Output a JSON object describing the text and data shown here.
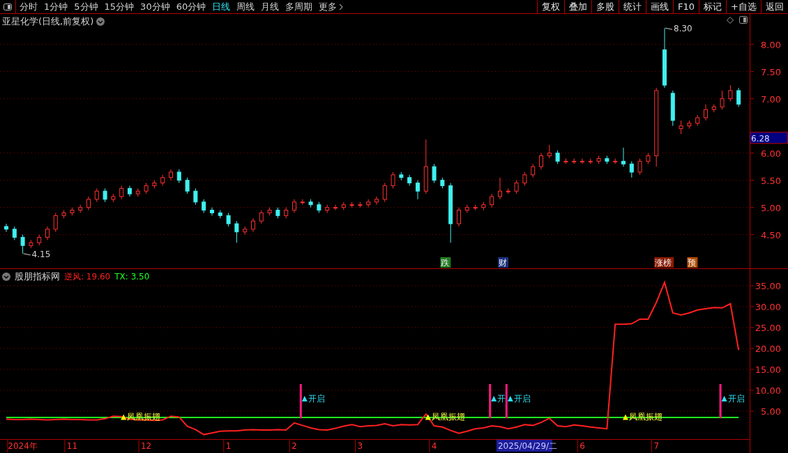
{
  "toolbar": {
    "tabs": [
      {
        "label": "分时",
        "selected": false
      },
      {
        "label": "1分钟",
        "selected": false
      },
      {
        "label": "5分钟",
        "selected": false
      },
      {
        "label": "15分钟",
        "selected": false
      },
      {
        "label": "30分钟",
        "selected": false
      },
      {
        "label": "60分钟",
        "selected": false
      },
      {
        "label": "日线",
        "selected": true
      },
      {
        "label": "周线",
        "selected": false
      },
      {
        "label": "月线",
        "selected": false
      },
      {
        "label": "多周期",
        "selected": false
      },
      {
        "label": "更多",
        "selected": false
      }
    ],
    "buttons": [
      "复权",
      "叠加",
      "多股",
      "统计",
      "画线",
      "F10",
      "标记",
      "+自选",
      "返回"
    ]
  },
  "price_panel": {
    "title": "亚星化学(日线,前复权)",
    "last_price": "6.28",
    "chart_data": {
      "type": "candlestick",
      "grid": true,
      "ylim": [
        3.88,
        8.56
      ],
      "yticks": [
        {
          "value": 4.5,
          "label": "4.50"
        },
        {
          "value": 5,
          "label": "5.00"
        },
        {
          "value": 5.5,
          "label": "5.50"
        },
        {
          "value": 6,
          "label": "6.00"
        },
        {
          "value": 7,
          "label": "7.00"
        },
        {
          "value": 7.5,
          "label": "7.50"
        },
        {
          "value": 8,
          "label": "8.00"
        }
      ],
      "categories": [
        null,
        null,
        null,
        null,
        null,
        null,
        null,
        null,
        null,
        null,
        null,
        null,
        null,
        null,
        null,
        null,
        null,
        null,
        null,
        null,
        null,
        null,
        null,
        null,
        null,
        null,
        null,
        null,
        null,
        null,
        null,
        null,
        null,
        null,
        null,
        null,
        null,
        null,
        null,
        null,
        null,
        null,
        null,
        null,
        null,
        null,
        null,
        null,
        null,
        null,
        null,
        null,
        null,
        null,
        null,
        null,
        null,
        null,
        null,
        null,
        null,
        null,
        null,
        null,
        null,
        null,
        null,
        null,
        null,
        null,
        null,
        null,
        null,
        null,
        null,
        null,
        null,
        null,
        null,
        null,
        null,
        null,
        null,
        null,
        null,
        null,
        null,
        null,
        null,
        null
      ],
      "ohlc": [
        [
          4.65,
          4.7,
          4.55,
          4.6
        ],
        [
          4.6,
          4.65,
          4.4,
          4.45
        ],
        [
          4.45,
          4.5,
          4.15,
          4.3
        ],
        [
          4.3,
          4.4,
          4.25,
          4.35
        ],
        [
          4.35,
          4.5,
          4.3,
          4.45
        ],
        [
          4.45,
          4.65,
          4.4,
          4.6
        ],
        [
          4.6,
          4.9,
          4.55,
          4.85
        ],
        [
          4.85,
          4.95,
          4.8,
          4.9
        ],
        [
          4.9,
          5.0,
          4.85,
          4.95
        ],
        [
          4.95,
          5.05,
          4.9,
          5.0
        ],
        [
          5.0,
          5.2,
          4.95,
          5.15
        ],
        [
          5.15,
          5.35,
          5.1,
          5.3
        ],
        [
          5.3,
          5.35,
          5.1,
          5.15
        ],
        [
          5.15,
          5.25,
          5.1,
          5.2
        ],
        [
          5.2,
          5.4,
          5.15,
          5.35
        ],
        [
          5.35,
          5.4,
          5.2,
          5.25
        ],
        [
          5.25,
          5.35,
          5.2,
          5.3
        ],
        [
          5.3,
          5.45,
          5.25,
          5.4
        ],
        [
          5.4,
          5.5,
          5.35,
          5.45
        ],
        [
          5.45,
          5.6,
          5.4,
          5.55
        ],
        [
          5.55,
          5.7,
          5.5,
          5.65
        ],
        [
          5.65,
          5.7,
          5.45,
          5.5
        ],
        [
          5.5,
          5.55,
          5.25,
          5.3
        ],
        [
          5.3,
          5.35,
          5.05,
          5.1
        ],
        [
          5.1,
          5.15,
          4.9,
          4.95
        ],
        [
          4.95,
          5.0,
          4.85,
          4.9
        ],
        [
          4.9,
          4.95,
          4.8,
          4.85
        ],
        [
          4.85,
          4.9,
          4.65,
          4.7
        ],
        [
          4.7,
          4.75,
          4.35,
          4.55
        ],
        [
          4.55,
          4.65,
          4.5,
          4.6
        ],
        [
          4.6,
          4.8,
          4.55,
          4.75
        ],
        [
          4.75,
          4.95,
          4.7,
          4.9
        ],
        [
          4.9,
          5.0,
          4.85,
          4.95
        ],
        [
          4.95,
          5.0,
          4.8,
          4.85
        ],
        [
          4.85,
          5.0,
          4.8,
          4.95
        ],
        [
          4.95,
          5.15,
          4.9,
          5.1
        ],
        [
          5.1,
          5.15,
          5.05,
          5.1
        ],
        [
          5.1,
          5.15,
          5.0,
          5.05
        ],
        [
          5.05,
          5.1,
          4.9,
          4.95
        ],
        [
          4.95,
          5.05,
          4.9,
          5.0
        ],
        [
          5.0,
          5.05,
          4.95,
          5.0
        ],
        [
          5.0,
          5.1,
          4.95,
          5.05
        ],
        [
          5.05,
          5.1,
          5.0,
          5.05
        ],
        [
          5.05,
          5.1,
          5.0,
          5.05
        ],
        [
          5.05,
          5.15,
          5.0,
          5.1
        ],
        [
          5.1,
          5.2,
          5.05,
          5.15
        ],
        [
          5.15,
          5.45,
          5.1,
          5.4
        ],
        [
          5.4,
          5.65,
          5.35,
          5.6
        ],
        [
          5.6,
          5.65,
          5.5,
          5.55
        ],
        [
          5.55,
          5.6,
          5.4,
          5.45
        ],
        [
          5.45,
          5.5,
          5.15,
          5.3
        ],
        [
          5.3,
          6.25,
          5.25,
          5.75
        ],
        [
          5.75,
          5.8,
          5.45,
          5.5
        ],
        [
          5.5,
          5.55,
          5.35,
          5.4
        ],
        [
          5.4,
          5.45,
          4.35,
          4.7
        ],
        [
          4.7,
          5.0,
          4.65,
          4.95
        ],
        [
          4.95,
          5.05,
          4.9,
          5.0
        ],
        [
          5.0,
          5.05,
          4.95,
          5.0
        ],
        [
          5.0,
          5.1,
          4.95,
          5.05
        ],
        [
          5.05,
          5.25,
          5.0,
          5.2
        ],
        [
          5.2,
          5.55,
          5.15,
          5.3
        ],
        [
          5.3,
          5.35,
          5.25,
          5.3
        ],
        [
          5.3,
          5.5,
          5.25,
          5.45
        ],
        [
          5.45,
          5.65,
          5.4,
          5.6
        ],
        [
          5.6,
          5.8,
          5.55,
          5.75
        ],
        [
          5.75,
          6.0,
          5.7,
          5.95
        ],
        [
          5.95,
          6.15,
          5.9,
          6.0
        ],
        [
          6.0,
          6.05,
          5.8,
          5.85
        ],
        [
          5.85,
          5.9,
          5.8,
          5.85
        ],
        [
          5.85,
          5.9,
          5.8,
          5.85
        ],
        [
          5.85,
          5.9,
          5.8,
          5.85
        ],
        [
          5.85,
          5.9,
          5.8,
          5.85
        ],
        [
          5.85,
          5.95,
          5.8,
          5.9
        ],
        [
          5.9,
          5.95,
          5.8,
          5.85
        ],
        [
          5.85,
          5.9,
          5.8,
          5.85
        ],
        [
          5.85,
          6.1,
          5.75,
          5.8
        ],
        [
          5.8,
          5.85,
          5.55,
          5.65
        ],
        [
          5.65,
          5.9,
          5.6,
          5.85
        ],
        [
          5.85,
          6.0,
          5.8,
          5.95
        ],
        [
          5.95,
          7.2,
          5.75,
          7.15
        ],
        [
          7.9,
          8.3,
          7.2,
          7.25
        ],
        [
          7.1,
          7.15,
          6.5,
          6.6
        ],
        [
          6.45,
          6.6,
          6.35,
          6.5
        ],
        [
          6.5,
          6.6,
          6.45,
          6.55
        ],
        [
          6.55,
          6.7,
          6.5,
          6.65
        ],
        [
          6.65,
          6.9,
          6.6,
          6.8
        ],
        [
          6.8,
          6.9,
          6.75,
          6.85
        ],
        [
          6.85,
          7.15,
          6.8,
          7.0
        ],
        [
          7.0,
          7.25,
          6.95,
          7.15
        ],
        [
          7.15,
          7.2,
          6.85,
          6.9
        ]
      ],
      "annotations": [
        "4.15",
        "8.30"
      ]
    },
    "event_tags": [
      {
        "label": "跌",
        "color": "#1f7a1f"
      },
      {
        "label": "财",
        "color": "#1b2f7a"
      },
      {
        "label": "涨榜",
        "color": "#8b1a00"
      },
      {
        "label": "预",
        "color": "#b04a00"
      }
    ]
  },
  "indicator_panel": {
    "title": "股朋指标网",
    "legend": [
      {
        "text": "逆风: 19.60",
        "color": "#ff2020"
      },
      {
        "text": "TX: 3.50",
        "color": "#20ff20"
      }
    ],
    "chart_data": {
      "type": "line",
      "grid": true,
      "ylim": [
        -1.67,
        39
      ],
      "yticks": [
        {
          "value": 5,
          "label": "5.00"
        },
        {
          "value": 10,
          "label": "10.00"
        },
        {
          "value": 15,
          "label": "15.00"
        },
        {
          "value": 20,
          "label": "20.00"
        },
        {
          "value": 25,
          "label": "25.00"
        },
        {
          "value": 30,
          "label": "30.00"
        },
        {
          "value": 35,
          "label": "35.00"
        }
      ],
      "categories": [
        null,
        null,
        "2024年",
        null,
        null,
        null,
        null,
        null,
        "11",
        null,
        null,
        null,
        null,
        null,
        null,
        null,
        null,
        "12",
        null,
        null,
        null,
        null,
        null,
        null,
        null,
        null,
        null,
        "1",
        null,
        null,
        null,
        null,
        null,
        null,
        null,
        "2",
        null,
        null,
        null,
        null,
        null,
        null,
        null,
        "3",
        null,
        null,
        null,
        null,
        null,
        null,
        null,
        null,
        "4",
        null,
        null,
        null,
        null,
        null,
        null,
        null,
        null,
        null,
        null,
        null,
        null,
        null,
        null,
        null,
        null,
        null,
        "6",
        null,
        null,
        null,
        null,
        null,
        null,
        null,
        null,
        "7",
        null,
        null,
        null,
        null,
        null,
        null,
        null,
        null,
        null,
        null
      ],
      "series": [
        {
          "color": "#ff2020",
          "values": [
            3.1,
            3.0,
            3.0,
            3.1,
            3.0,
            2.9,
            3.0,
            3.1,
            3.0,
            3.0,
            2.9,
            2.9,
            3.2,
            3.8,
            3.7,
            3.1,
            2.9,
            2.9,
            2.8,
            2.9,
            3.8,
            3.6,
            1.4,
            0.6,
            -0.6,
            -0.2,
            0.2,
            0.3,
            0.3,
            0.5,
            0.6,
            0.5,
            0.5,
            0.6,
            0.5,
            2.2,
            1.6,
            1.0,
            0.6,
            0.5,
            0.9,
            1.4,
            1.8,
            1.3,
            1.5,
            1.6,
            2.0,
            1.5,
            1.8,
            1.7,
            1.8,
            4.3,
            1.5,
            1.2,
            0.4,
            -0.3,
            0.2,
            0.8,
            1.0,
            1.5,
            1.3,
            0.8,
            1.2,
            1.8,
            1.6,
            2.3,
            3.3,
            1.5,
            1.3,
            1.7,
            1.5,
            1.2,
            1.0,
            0.8,
            25.8,
            25.8,
            25.9,
            27.0,
            27.0,
            31,
            35.8,
            28.5,
            28.0,
            28.5,
            29.2,
            29.5,
            29.8,
            29.7,
            30.7,
            19.6
          ]
        },
        {
          "color": "#20ff20",
          "values": [
            3.5,
            3.5,
            3.5,
            3.5,
            3.5,
            3.5,
            3.5,
            3.5,
            3.5,
            3.5,
            3.5,
            3.5,
            3.5,
            3.5,
            3.5,
            3.5,
            3.5,
            3.5,
            3.5,
            3.5,
            3.5,
            3.5,
            3.5,
            3.5,
            3.5,
            3.5,
            3.5,
            3.5,
            3.5,
            3.5,
            3.5,
            3.5,
            3.5,
            3.5,
            3.5,
            3.5,
            3.5,
            3.5,
            3.5,
            3.5,
            3.5,
            3.5,
            3.5,
            3.5,
            3.5,
            3.5,
            3.5,
            3.5,
            3.5,
            3.5,
            3.5,
            3.5,
            3.5,
            3.5,
            3.5,
            3.5,
            3.5,
            3.5,
            3.5,
            3.5,
            3.5,
            3.5,
            3.5,
            3.5,
            3.5,
            3.5,
            3.5,
            3.5,
            3.5,
            3.5,
            3.5,
            3.5,
            3.5,
            3.5,
            3.5,
            3.5,
            3.5,
            3.5,
            3.5,
            3.5,
            3.5,
            3.5,
            3.5,
            3.5,
            3.5,
            3.5,
            3.5,
            3.5,
            3.5,
            3.5
          ]
        }
      ]
    },
    "signals": [
      {
        "kind": "rise",
        "label": "凤凰振翅"
      },
      {
        "kind": "open",
        "label": "开启"
      },
      {
        "kind": "rise",
        "label": "凤凰振翅"
      },
      {
        "kind": "open",
        "label": "开"
      },
      {
        "kind": "open",
        "label": "开启"
      },
      {
        "kind": "rise",
        "label": "凤凰振翅"
      },
      {
        "kind": "open",
        "label": "开启"
      }
    ],
    "cursor_date": "2025/04/29/二"
  }
}
